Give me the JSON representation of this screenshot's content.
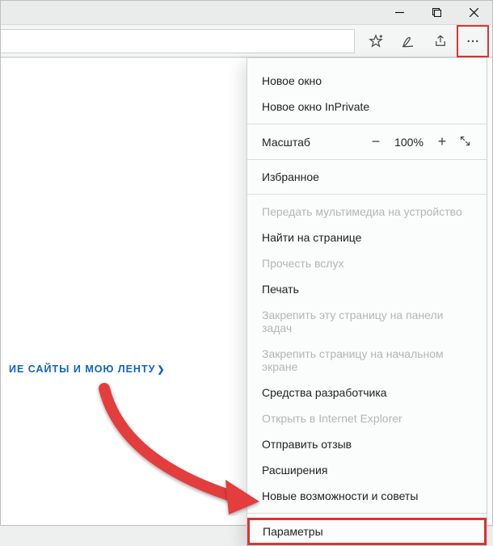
{
  "menu": {
    "new_window": "Новое окно",
    "new_inprivate": "Новое окно InPrivate",
    "zoom_label": "Масштаб",
    "zoom_value": "100%",
    "favorites": "Избранное",
    "cast": "Передать мультимедиа на устройство",
    "find": "Найти на странице",
    "read_aloud": "Прочесть вслух",
    "print": "Печать",
    "pin_taskbar": "Закрепить эту страницу на панели задач",
    "pin_start": "Закрепить страницу на начальном экране",
    "dev_tools": "Средства разработчика",
    "open_ie": "Открыть в Internet Explorer",
    "feedback": "Отправить отзыв",
    "extensions": "Расширения",
    "whats_new": "Новые возможности и советы",
    "settings": "Параметры"
  },
  "content": {
    "feed_link": "ИЕ САЙТЫ И МОЮ ЛЕНТУ"
  }
}
